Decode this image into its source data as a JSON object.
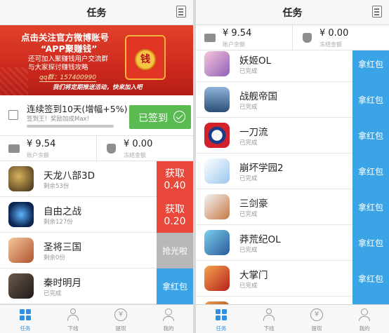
{
  "left": {
    "nav_title": "任务",
    "banner": {
      "line1": "点击关注官方微博账号",
      "line2": "“APP聚赚钱”",
      "line3": "还可加入聚赚钱用户交流群",
      "line4": "与大家探讨赚钱攻略",
      "qq": "qq群：157400990",
      "line5": "我们将定期推送活动，快来加入吧",
      "envelope_char": "钱"
    },
    "signin": {
      "title": "连续签到10天(增幅+5%)",
      "sub": "签到王！奖励加成Max!",
      "button": "已签到",
      "progress": 1.0
    },
    "balance": {
      "account_amount": "¥ 9.54",
      "account_label": "账户余额",
      "frozen_amount": "¥ 0.00",
      "frozen_label": "冻结金额"
    },
    "tasks": [
      {
        "name": "天龙八部3D",
        "note": "剩余53份",
        "icon": "tianlong-game-icon",
        "action_line1": "获取",
        "action_line2": "0.40",
        "style": "red"
      },
      {
        "name": "自由之战",
        "note": "剩余127份",
        "icon": "ziyou-game-icon",
        "action_line1": "获取",
        "action_line2": "0.20",
        "style": "red"
      },
      {
        "name": "圣将三国",
        "note": "剩余0份",
        "icon": "shengjiang-game-icon",
        "action_line1": "抢光啦",
        "action_line2": "",
        "style": "gray"
      },
      {
        "name": "秦时明月",
        "note": "已完成",
        "icon": "qinshi-game-icon",
        "action_line1": "拿红包",
        "action_line2": "",
        "style": "blue"
      }
    ]
  },
  "right": {
    "nav_title": "任务",
    "balance": {
      "account_amount": "¥ 9.54",
      "account_label": "账户余额",
      "frozen_amount": "¥ 0.00",
      "frozen_label": "冻结金额"
    },
    "tasks": [
      {
        "name": "妖姬OL",
        "note": "已完成",
        "icon": "yaoji-game-icon",
        "action": "拿红包"
      },
      {
        "name": "战舰帝国",
        "note": "已完成",
        "icon": "zhanjian-game-icon",
        "action": "拿红包"
      },
      {
        "name": "一刀流",
        "note": "已完成",
        "icon": "yidao-game-icon",
        "action": "拿红包"
      },
      {
        "name": "崩坏学园2",
        "note": "已完成",
        "icon": "benghuai-game-icon",
        "action": "拿红包"
      },
      {
        "name": "三剑豪",
        "note": "已完成",
        "icon": "sanjian-game-icon",
        "action": "拿红包"
      },
      {
        "name": "莽荒纪OL",
        "note": "已完成",
        "icon": "manghuang-game-icon",
        "action": "拿红包"
      },
      {
        "name": "大掌门",
        "note": "已完成",
        "icon": "dazhang-game-icon",
        "action": "拿红包"
      }
    ]
  },
  "tabbar": [
    {
      "label": "任务",
      "icon": "grid-icon",
      "active": true
    },
    {
      "label": "下线",
      "icon": "person-icon",
      "active": false
    },
    {
      "label": "提现",
      "icon": "yen-icon",
      "active": false
    },
    {
      "label": "我的",
      "icon": "user-icon",
      "active": false
    }
  ],
  "colors": {
    "accent_blue": "#3aa4e6",
    "action_red": "#e8473a",
    "signed_green": "#5bbb53",
    "banner_red": "#d2311f"
  }
}
